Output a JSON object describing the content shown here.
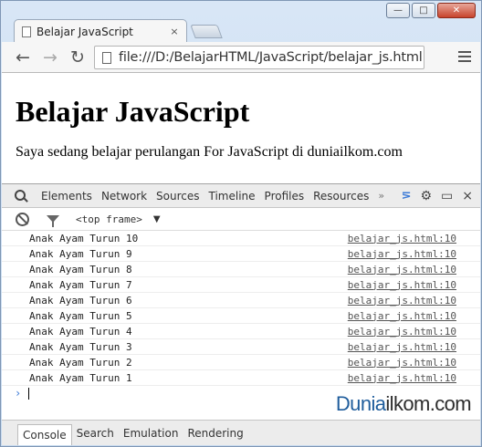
{
  "browser": {
    "tab_title": "Belajar JavaScript",
    "tab_close": "×",
    "url": "file:///D:/BelajarHTML/JavaScript/belajar_js.html",
    "window_controls": {
      "minimize": "—",
      "maximize": "□",
      "close": "✕"
    },
    "nav": {
      "back": "←",
      "forward": "→",
      "reload": "↻"
    }
  },
  "page": {
    "heading": "Belajar JavaScript",
    "paragraph": "Saya sedang belajar perulangan For JavaScript di duniailkom.com"
  },
  "devtools": {
    "tabs": [
      "Elements",
      "Network",
      "Sources",
      "Timeline",
      "Profiles",
      "Resources"
    ],
    "more": "»",
    "close": "×",
    "frame": "<top frame>",
    "frame_caret": "▼",
    "console_rows": [
      {
        "message": "Anak Ayam Turun 10",
        "source": "belajar_js.html:10"
      },
      {
        "message": "Anak Ayam Turun 9",
        "source": "belajar_js.html:10"
      },
      {
        "message": "Anak Ayam Turun 8",
        "source": "belajar_js.html:10"
      },
      {
        "message": "Anak Ayam Turun 7",
        "source": "belajar_js.html:10"
      },
      {
        "message": "Anak Ayam Turun 6",
        "source": "belajar_js.html:10"
      },
      {
        "message": "Anak Ayam Turun 5",
        "source": "belajar_js.html:10"
      },
      {
        "message": "Anak Ayam Turun 4",
        "source": "belajar_js.html:10"
      },
      {
        "message": "Anak Ayam Turun 3",
        "source": "belajar_js.html:10"
      },
      {
        "message": "Anak Ayam Turun 2",
        "source": "belajar_js.html:10"
      },
      {
        "message": "Anak Ayam Turun 1",
        "source": "belajar_js.html:10"
      }
    ],
    "prompt": "›",
    "drawer_tabs": [
      "Console",
      "Search",
      "Emulation",
      "Rendering"
    ],
    "active_drawer_tab": "Console"
  },
  "watermark": {
    "part1": "Dunia",
    "part2": "ilkom.com"
  },
  "colors": {
    "link_blue": "#3d7bd7",
    "watermark_blue": "#1f5d9c"
  }
}
